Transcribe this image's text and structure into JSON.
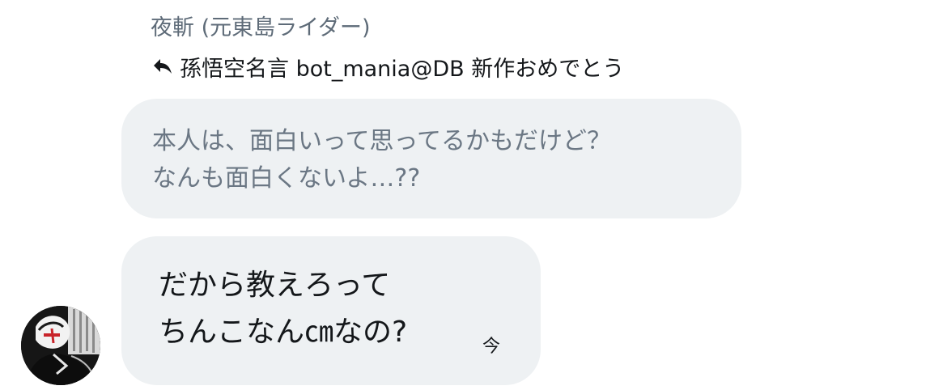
{
  "message": {
    "sender_name": "夜斬 (元東島ライダー)",
    "reply_to": {
      "icon": "reply-arrow-icon",
      "text": "孫悟空名言 bot_mania@DB 新作おめでとう"
    },
    "quoted_lines": [
      "本人は、面白いって思ってるかもだけど？",
      "なんも面白くないよ…??"
    ],
    "body_lines": [
      "だから教えろって",
      "ちんこなん㎝なの?"
    ],
    "timestamp": "今",
    "avatar_icon": "user-avatar"
  }
}
